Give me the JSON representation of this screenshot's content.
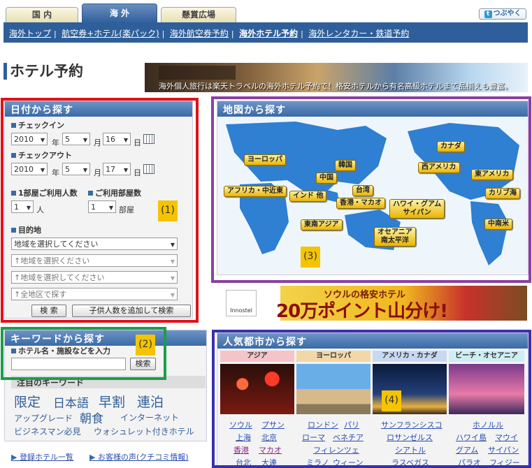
{
  "tabs": {
    "domestic": "国 内",
    "overseas": "海 外",
    "contest": "懸賞広場"
  },
  "tweet": {
    "icon": "t",
    "label": "つぶやく"
  },
  "nav": {
    "items": [
      "海外トップ",
      "航空券+ホテル(楽パック)",
      "海外航空券予約",
      "海外ホテル予約",
      "海外レンタカー・鉄道予約"
    ],
    "separator": "|"
  },
  "page_title": "ホテル予約",
  "banner_caption": "海外個人旅行は楽天トラベルの海外ホテル予約で！格安ホテルから有名高級ホテルまで品揃えも豊富。",
  "date_search": {
    "heading": "日付から探す",
    "checkin_label": "チェックイン",
    "checkout_label": "チェックアウト",
    "checkin": {
      "year": "2010",
      "month": "5",
      "day": "16"
    },
    "checkout": {
      "year": "2010",
      "month": "5",
      "day": "17"
    },
    "year_unit": "年",
    "month_unit": "月",
    "day_unit": "日",
    "persons_label": "1部屋ご利用人数",
    "persons_value": "1",
    "persons_unit": "人",
    "rooms_label": "ご利用部屋数",
    "rooms_value": "1",
    "rooms_unit": "部屋",
    "dest_label": "目的地",
    "dest_selects": [
      "地域を選択してください",
      "↑地域を選択ください",
      "↑地域を選択してください",
      "↑全地区で探す"
    ],
    "search_button": "検 索",
    "child_button": "子供人数を追加して検索"
  },
  "keyword_search": {
    "heading": "キーワードから探す",
    "label": "ホテル名・施設などを入力",
    "input_value": "",
    "search_button": "検索",
    "popular_heading": "注目のキーワード",
    "keywords": [
      "限定",
      "日本語",
      "早割",
      "連泊",
      "アップグレード",
      "朝食",
      "インターネット",
      "ビジネスマン必見",
      "ウォシュレット付きホテル"
    ]
  },
  "map_search": {
    "heading": "地図から探す",
    "regions": [
      "ヨーロッパ",
      "韓国",
      "中国",
      "アフリカ・中近東",
      "インド 他",
      "台湾",
      "香港・マカオ",
      "ハワイ・グアム\nサイパン",
      "東南アジア",
      "オセアニア\n南太平洋",
      "カナダ",
      "西アメリカ",
      "東アメリカ",
      "カリブ海",
      "中南米"
    ]
  },
  "ad": {
    "brand": "Innostel",
    "text1": "ソウルの格安ホテル",
    "text2": "20万ポイント山分け!"
  },
  "popular": {
    "heading": "人気都市から探す",
    "columns": [
      {
        "title": "アジア",
        "color": "#f4c4c8",
        "cities": [
          "ソウル",
          "プサン",
          "上海",
          "北京",
          "香港",
          "マカオ",
          "台北",
          "大連"
        ]
      },
      {
        "title": "ヨーロッパ",
        "color": "#f2d7a8",
        "cities": [
          "ロンドン",
          "パリ",
          "ローマ",
          "ベネチア",
          "フィレンツェ",
          "ミラノ",
          "ウィーン"
        ]
      },
      {
        "title": "アメリカ・カナダ",
        "color": "#c9d8f2",
        "cities": [
          "サンフランシスコ",
          "ロサンゼルス",
          "シアトル",
          "ラスベガス"
        ]
      },
      {
        "title": "ビーチ・オセアニア",
        "color": "#cdeef2",
        "cities": [
          "ホノルル",
          "ハワイ島",
          "マウイ",
          "グアム",
          "サイパン",
          "パラオ",
          "フィジー"
        ]
      }
    ]
  },
  "footer": {
    "link1": "登録ホテル一覧",
    "link2": "お客様の声(クチコミ情報)"
  },
  "badges": {
    "b1": "(1)",
    "b2": "(2)",
    "b3": "(3)",
    "b4": "(4)"
  },
  "colors": {
    "navy": "#2f5f9a",
    "red_box": "#e0121a",
    "green_box": "#1aa04a",
    "purple_box": "#8a3fa5",
    "blue_box": "#3a2fb0",
    "badge": "#f5c400"
  }
}
